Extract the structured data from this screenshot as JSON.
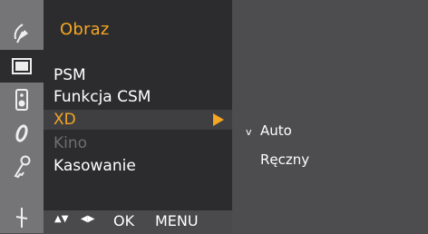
{
  "menu": {
    "title": "Obraz",
    "items": [
      {
        "label": "PSM",
        "state": "normal"
      },
      {
        "label": "Funkcja CSM",
        "state": "normal"
      },
      {
        "label": "XD",
        "state": "selected"
      },
      {
        "label": "Kino",
        "state": "disabled"
      },
      {
        "label": "Kasowanie",
        "state": "normal"
      }
    ]
  },
  "submenu": {
    "check_mark": "v",
    "options": [
      {
        "label": "Auto",
        "checked": true
      },
      {
        "label": "Ręczny",
        "checked": false
      }
    ]
  },
  "nav_hint": {
    "updown_symbol": "▲▼",
    "leftright_symbol": "◀▶",
    "ok_label": "OK",
    "menu_label": "MENU"
  },
  "icons": [
    "satellite-dish-icon",
    "picture-icon",
    "sound-icon",
    "clock-icon",
    "key-icon",
    "options-icon"
  ],
  "colors": {
    "accent": "#f5a623",
    "panel": "#2c2c2e",
    "background": "#4d4d4f",
    "icon_strip": "#757577"
  }
}
